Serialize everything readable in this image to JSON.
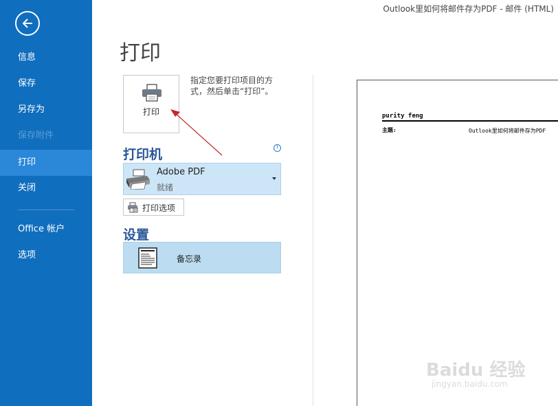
{
  "window": {
    "title": "Outlook里如何将邮件存为PDF - 邮件 (HTML)"
  },
  "sidebar": {
    "back_icon": "back-arrow-icon",
    "items": [
      {
        "label": "信息"
      },
      {
        "label": "保存"
      },
      {
        "label": "另存为"
      },
      {
        "label": "保存附件"
      },
      {
        "label": "打印"
      },
      {
        "label": "关闭"
      },
      {
        "label": "Office 帐户"
      },
      {
        "label": "选项"
      }
    ],
    "active_item": "打印",
    "disabled_item": "保存附件",
    "colors": {
      "background": "#106ebe",
      "active": "#2b88d8",
      "disabled_text": "#5e9fd6"
    }
  },
  "main": {
    "title": "打印",
    "print_button": {
      "label": "打印",
      "icon": "printer-icon"
    },
    "print_description": "指定您要打印项目的方式，然后单击“打印”。",
    "printer_section": {
      "title": "打印机",
      "info_icon": "info-icon",
      "selected_printer": {
        "name": "Adobe PDF",
        "status": "就绪",
        "icon": "printer-icon"
      },
      "options_button": {
        "label": "打印选项",
        "icon": "print-options-icon"
      }
    },
    "settings_section": {
      "title": "设置",
      "selected_style": {
        "label": "备忘录",
        "icon": "memo-style-icon"
      }
    }
  },
  "preview": {
    "sender": "purity feng",
    "subject_label": "主题:",
    "subject_value": "Outlook里如何将邮件存为PDF"
  },
  "watermark": {
    "brand": "Baidu 经验",
    "url": "jingyan.baidu.com"
  },
  "colors": {
    "section_title": "#2b579a",
    "selected_bg": "#cde6f7",
    "annotation_arrow": "#c0282d"
  }
}
